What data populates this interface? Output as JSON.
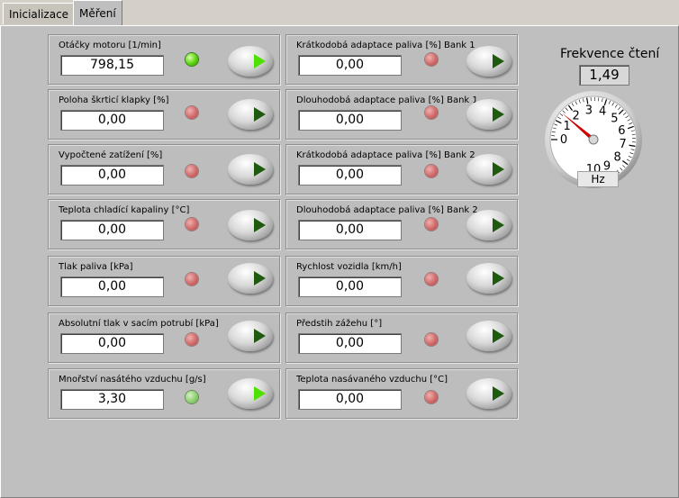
{
  "tabs": [
    {
      "label": "Inicializace"
    },
    {
      "label": "Měření"
    }
  ],
  "left": [
    {
      "label": "Otáčky motoru [1/min]",
      "value": "798,15",
      "led": "on",
      "active": true
    },
    {
      "label": "Poloha škrticí klapky [%]",
      "value": "0,00",
      "led": "off",
      "active": false
    },
    {
      "label": "Vypočtené zatížení [%]",
      "value": "0,00",
      "led": "off",
      "active": false
    },
    {
      "label": "Teplota chladící kapaliny [°C]",
      "value": "0,00",
      "led": "off",
      "active": false
    },
    {
      "label": "Tlak paliva [kPa]",
      "value": "0,00",
      "led": "off",
      "active": false
    },
    {
      "label": "Absolutní tlak v sacím potrubí [kPa]",
      "value": "0,00",
      "led": "off",
      "active": false
    },
    {
      "label": "Mnořství nasátého vzduchu [g/s]",
      "value": "3,30",
      "led": "dim",
      "active": true
    }
  ],
  "right": [
    {
      "label": "Krátkodobá adaptace paliva [%] Bank 1",
      "value": "0,00",
      "led": "off",
      "active": false
    },
    {
      "label": "Dlouhodobá adaptace paliva [%] Bank 1",
      "value": "0,00",
      "led": "off",
      "active": false
    },
    {
      "label": "Krátkodobá adaptace paliva [%] Bank 2",
      "value": "0,00",
      "led": "off",
      "active": false
    },
    {
      "label": "Dlouhodobá adaptace paliva [%]  Bank 2",
      "value": "0,00",
      "led": "off",
      "active": false
    },
    {
      "label": "Rychlost vozidla [km/h]",
      "value": "0,00",
      "led": "off",
      "active": false
    },
    {
      "label": "Předstih zážehu [°]",
      "value": "0,00",
      "led": "off",
      "active": false
    },
    {
      "label": "Teplota nasávaného vzduchu [°C]",
      "value": "0,00",
      "led": "off",
      "active": false
    }
  ],
  "frequency": {
    "title": "Frekvence čtení",
    "value": "1,49",
    "unit": "Hz",
    "needle_value": 1.49,
    "scale_min": 0,
    "scale_max": 10,
    "ticks": [
      "0",
      "1",
      "2",
      "3",
      "4",
      "5",
      "6",
      "7",
      "8",
      "9",
      "10"
    ]
  }
}
